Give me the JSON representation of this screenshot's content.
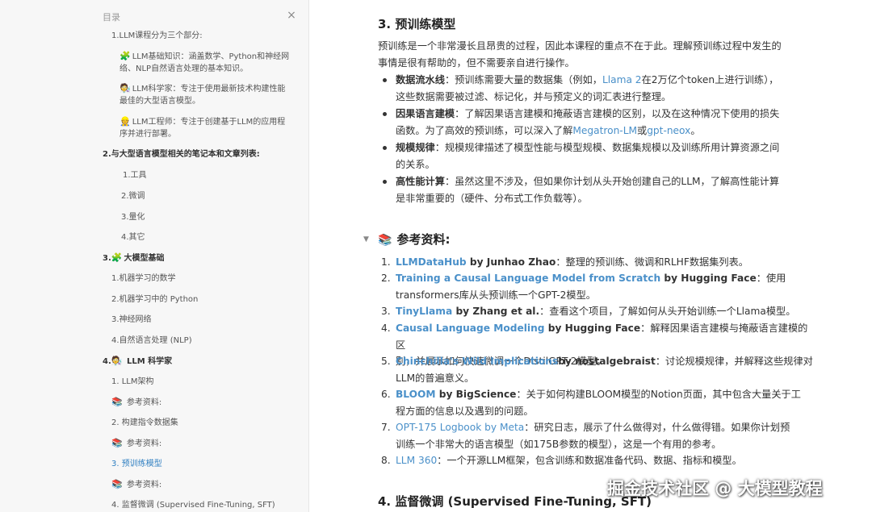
{
  "sidebar": {
    "header": "目录",
    "close_glyph": "×",
    "items": {
      "i1": "1.LLM课程分为三个部分:",
      "i1a_icon": "🧩",
      "i1a": "LLM基础知识：涵盖数学、Python和神经网络、NLP自然语言处理的基本知识。",
      "i1b_icon": "🧑‍🔬",
      "i1b": "LLM科学家：专注于使用最新技术构建性能最佳的大型语言模型。",
      "i1c_icon": "👷",
      "i1c": "LLM工程师：专注于创建基于LLM的应用程序并进行部署。",
      "i2": "2.与大型语言模型相关的笔记本和文章列表:",
      "i2a": "1.工具",
      "i2b": "2.微调",
      "i2c": "3.量化",
      "i2d": "4.其它",
      "i3": "3.",
      "i3_icon": "🧩",
      "i3_label": "大模型基础",
      "i3a": "1.机器学习的数学",
      "i3b": "2.机器学习中的 Python",
      "i3c": "3.神经网络",
      "i3d": "4.自然语言处理 (NLP)",
      "i4": "4.",
      "i4_icon": "🧑‍🔬",
      "i4_label": " LLM 科学家",
      "i4a": "1. LLM架构",
      "i4a_ref_icon": "📚",
      "i4a_ref": "参考资料:",
      "i4b": "2. 构建指令数据集",
      "i4b_ref_icon": "📚",
      "i4b_ref": "参考资料:",
      "i4c": "3. 预训练模型",
      "i4c_ref_icon": "📚",
      "i4c_ref": "参考资料:",
      "i4d": "4. 监督微调 (Supervised Fine-Tuning, SFT)"
    }
  },
  "main": {
    "section_title": "3. 预训练模型",
    "intro_1": "预训练是一个非常漫长且昂贵的过程，因此本课程的重点不在于此。理解预训练过程中发生的",
    "intro_2": "事情是很有帮助的，但不需要亲自进行操作。",
    "bullets": {
      "b1_term": "数据流水线",
      "b1_a": "：预训练需要大量的数据集（例如，",
      "b1_link": "Llama 2",
      "b1_b": "在2万亿个token上进行训练），",
      "b1_line2": "这些数据需要被过滤、标记化，并与预定义的词汇表进行整理。",
      "b2_term": "因果语言建模",
      "b2_a": "：了解因果语言建模和掩蔽语言建模的区别，以及在这种情况下使用的损失",
      "b2_line2a": "函数。为了高效的预训练，可以深入了解",
      "b2_link1": "Megatron-LM",
      "b2_or": "或",
      "b2_link2": "gpt-neox",
      "b2_end": "。",
      "b3_term": "规模规律",
      "b3_a": "：规模规律描述了模型性能与模型规模、数据集规模以及训练所用计算资源之间",
      "b3_line2": "的关系。",
      "b4_term": "高性能计算",
      "b4_a": "：虽然这里不涉及，但如果你计划从头开始创建自己的LLM，了解高性能计算",
      "b4_line2": "是非常重要的（硬件、分布式工作负载等）。"
    },
    "refs_arrow": "▼",
    "refs_icon": "📚",
    "refs_title": "参考资料:",
    "refs": {
      "r1_num": "1.",
      "r1_link": "LLMDataHub",
      "r1_by": " by Junhao Zhao",
      "r1_desc": "：整理的预训练、微调和RLHF数据集列表。",
      "r2_num": "2.",
      "r2_link": "Training a Causal Language Model from Scratch",
      "r2_by": " by Hugging Face",
      "r2_desc": "：使用",
      "r2_line2": "transformers库从头预训练一个GPT-2模型。",
      "r3_num": "3.",
      "r3_link": "TinyLlama",
      "r3_by": " by Zhang et al.",
      "r3_desc": "：查看这个项目，了解如何从头开始训练一个Llama模型。",
      "r4_num": "4.",
      "r4_link": "Causal Language Modeling",
      "r4_by": " by Hugging Face",
      "r4_desc": "：解释因果语言建模与掩蔽语言建模的区",
      "r4_line2": "别，并展示如何快速微调一个DistilGPT-2模型。",
      "r5_num": "5.",
      "r5_link": "Chinchilla's Wild Implications",
      "r5_by": "by nostalgebraist",
      "r5_desc": "：讨论规模规律，并解释这些规律对",
      "r5_line2": "LLM的普遍意义。",
      "r6_num": "6.",
      "r6_link": "BLOOM",
      "r6_by": " by BigScience",
      "r6_desc": "：关于如何构建BLOOM模型的Notion页面，其中包含大量关于工",
      "r6_line2": "程方面的信息以及遇到的问题。",
      "r7_num": "7.",
      "r7_link": "OPT-175 Logbook by Meta",
      "r7_desc": "：研究日志，展示了什么做得对，什么做得错。如果你计划预",
      "r7_line2": "训练一个非常大的语言模型（如175B参数的模型），这是一个有用的参考。",
      "r8_num": "8.",
      "r8_link": "LLM 360",
      "r8_desc": "：一个开源LLM框架，包含训练和数据准备代码、数据、指标和模型。"
    },
    "next_section_title": "4. 监督微调 (Supervised Fine-Tuning, SFT)",
    "watermark": "掘金技术社区 @ 大模型教程"
  },
  "colors": {
    "link": "#4a90c9",
    "active_toc": "#2f7fc1",
    "sidebar_bg": "#f7f7f7"
  }
}
